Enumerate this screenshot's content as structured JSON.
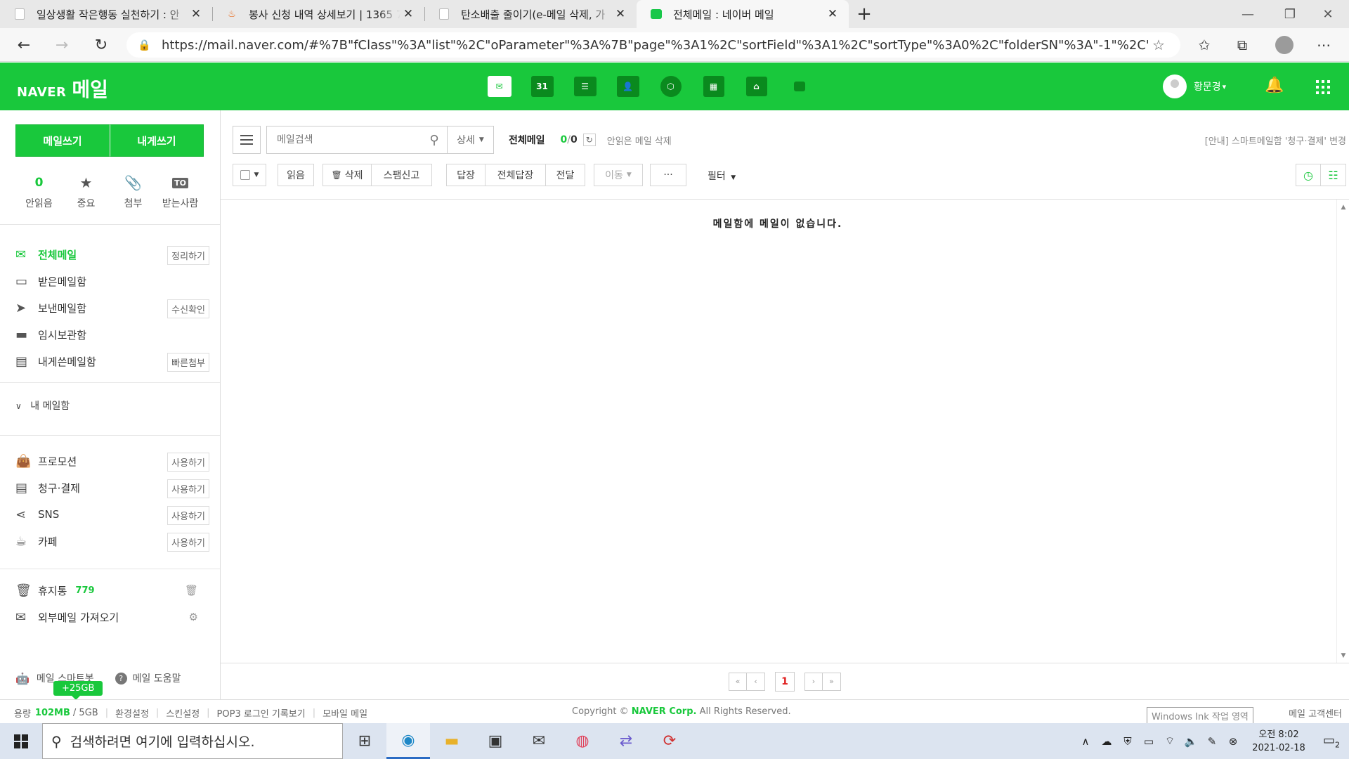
{
  "browser": {
    "tabs": [
      {
        "title": "일상생활 작은행동 실천하기 : 안",
        "active": false,
        "favicon": "doc"
      },
      {
        "title": "봉사 신청 내역 상세보기 | 1365 7",
        "active": false,
        "favicon": "fire"
      },
      {
        "title": "탄소배출 줄이기(e-메일 삭제, 가",
        "active": false,
        "favicon": "doc"
      },
      {
        "title": "전체메일 : 네이버 메일",
        "active": true,
        "favicon": "naver"
      }
    ],
    "url": "https://mail.naver.com/#%7B\"fClass\"%3A\"list\"%2C\"oParameter\"%3A%7B\"page\"%3A1%2C\"sortField\"%3A1%2C\"sortType\"%3A0%2C\"folderSN\"%3A\"-1\"%2C\"t..."
  },
  "header": {
    "brand": "NAVER",
    "service": "메일",
    "user_name": "황문경",
    "user_caret": "▾"
  },
  "sidebar": {
    "write_mail": "메일쓰기",
    "write_self": "내게쓰기",
    "quick": [
      {
        "value": "0",
        "label": "안읽음"
      },
      {
        "icon": "star-icon",
        "label": "중요"
      },
      {
        "icon": "clip-icon",
        "label": "첨부"
      },
      {
        "icon_text": "TO",
        "label": "받는사람"
      }
    ],
    "folders": [
      {
        "label": "전체메일",
        "badge": "정리하기",
        "icon": "mail-all-icon"
      },
      {
        "label": "받은메일함",
        "badge": "",
        "icon": "inbox-icon"
      },
      {
        "label": "보낸메일함",
        "badge": "수신확인",
        "icon": "send-icon"
      },
      {
        "label": "임시보관함",
        "badge": "",
        "icon": "folder-icon"
      },
      {
        "label": "내게쓴메일함",
        "badge": "빠른첨부",
        "icon": "note-icon"
      }
    ],
    "my_mailbox": "내 메일함",
    "extras": [
      {
        "label": "프로모션",
        "badge": "사용하기",
        "icon": "bag-icon"
      },
      {
        "label": "청구·결제",
        "badge": "사용하기",
        "icon": "list-icon"
      },
      {
        "label": "SNS",
        "badge": "사용하기",
        "icon": "share-icon"
      },
      {
        "label": "카페",
        "badge": "사용하기",
        "icon": "cup-icon"
      }
    ],
    "trash": {
      "label": "휴지통",
      "count": "779"
    },
    "external": {
      "label": "외부메일 가져오기"
    },
    "smartbot": "메일 스마트봇",
    "help": "메일 도움말",
    "capacity_badge": "+25GB"
  },
  "main": {
    "search_placeholder": "메일검색",
    "search_detail": "상세",
    "folder_name": "전체메일",
    "unread_count": "0",
    "slash": "/",
    "total_count": "0",
    "delete_unread": "안읽은 메일 삭제",
    "notice": "[안내] 스마트메일함 '청구·결제' 변경",
    "toolbar": {
      "read": "읽음",
      "delete": "삭제",
      "spam": "스팸신고",
      "reply": "답장",
      "reply_all": "전체답장",
      "forward": "전달",
      "move": "이동",
      "more": "···",
      "filter": "필터"
    },
    "empty_message": "메일함에 메일이 없습니다.",
    "page_number": "1"
  },
  "footer": {
    "usage_label": "용량",
    "usage_used": "102MB",
    "usage_total": "/ 5GB",
    "links": [
      "환경설정",
      "스킨설정",
      "POP3 로그인 기록보기",
      "모바일 메일"
    ],
    "copyright_prefix": "Copyright ©",
    "copyright_corp": "NAVER Corp.",
    "copyright_suffix": "All Rights Reserved.",
    "support": "메일 고객센터",
    "windows_overlay": "Windows Ink 작업 영역"
  },
  "taskbar": {
    "search_placeholder": "검색하려면 여기에 입력하십시오.",
    "time": "오전 8:02",
    "date": "2021-02-18",
    "notification_count": "2"
  },
  "colors": {
    "accent": "#19c83c",
    "page_number": "#e02020"
  }
}
